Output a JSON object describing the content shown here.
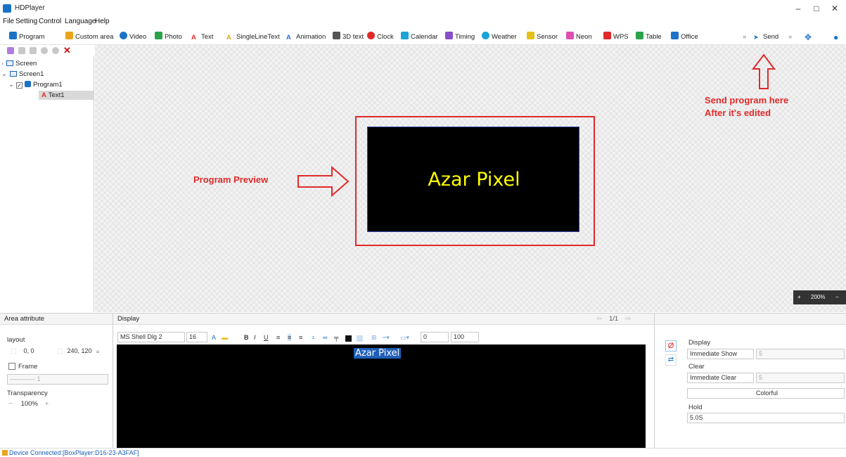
{
  "app": {
    "title": "HDPlayer",
    "min": "–",
    "max": "□",
    "close": "✕"
  },
  "menu": [
    "File",
    "Setting",
    "Control",
    "Language",
    "Help"
  ],
  "toolbar": [
    {
      "label": "Program",
      "color": "#1a73c7"
    },
    {
      "label": "Custom area",
      "color": "#e8a41b"
    },
    {
      "label": "Video",
      "color": "#1a73c7"
    },
    {
      "label": "Photo",
      "color": "#2aa24a"
    },
    {
      "label": "Text",
      "color": "#e02a2a"
    },
    {
      "label": "SingleLineText",
      "color": "#e8a41b"
    },
    {
      "label": "Animation",
      "color": "#2a6fe0"
    },
    {
      "label": "3D text",
      "color": "#555555"
    },
    {
      "label": "Clock",
      "color": "#e02a2a"
    },
    {
      "label": "Calendar",
      "color": "#1aa3d6"
    },
    {
      "label": "Timing",
      "color": "#8a4fc7"
    },
    {
      "label": "Weather",
      "color": "#1aa3d6"
    },
    {
      "label": "Sensor",
      "color": "#e8c01b"
    },
    {
      "label": "Neon",
      "color": "#e04fb0"
    },
    {
      "label": "WPS",
      "color": "#e02a2a"
    },
    {
      "label": "Table",
      "color": "#2aa24a"
    },
    {
      "label": "Office",
      "color": "#1a73c7"
    }
  ],
  "send": {
    "label": "Send",
    "more": "»"
  },
  "tree": {
    "screen": "Screen",
    "screen1": "Screen1",
    "program1": "Program1",
    "text1": "Text1"
  },
  "preview": {
    "text": "Azar Pixel"
  },
  "annotations": {
    "preview": "Program Preview",
    "send_line1": "Send program here",
    "send_line2": "After it's edited"
  },
  "zoom": {
    "plus": "+",
    "value": "200%",
    "minus": "−"
  },
  "area": {
    "header": "Area attribute",
    "layout": "layout",
    "pos": "0, 0",
    "size": "240, 120",
    "frame": "Frame",
    "frame_value": "———— 1",
    "transparency": "Transparency",
    "transparency_value": "100%",
    "dec": "−",
    "inc": "+"
  },
  "display": {
    "header": "Display",
    "page": "1/1",
    "font": "MS Shell Dlg 2",
    "size": "16",
    "n1": "0",
    "n2": "100",
    "editor_text": "Azar Pixel"
  },
  "effects": {
    "display_label": "Display",
    "display_value": "Immediate Show",
    "display_speed": "5",
    "clear_label": "Clear",
    "clear_value": "Immediate Clear",
    "clear_speed": "5",
    "color_value": "Colorful",
    "hold_label": "Hold",
    "hold_value": "5.0S"
  },
  "status": {
    "text": "Device Connected:[BoxPlayer:D16-23-A3FAF]"
  }
}
